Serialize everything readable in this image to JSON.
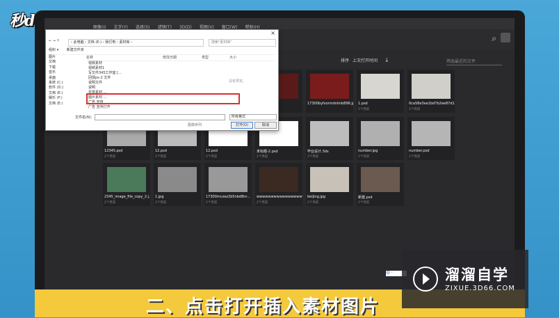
{
  "logo": "秒dong视频",
  "ps": {
    "menu": [
      "图像(I)",
      "文字(Y)",
      "选择(S)",
      "滤镜(T)",
      "3D(D)",
      "视图(V)",
      "窗口(W)",
      "帮助(H)"
    ],
    "sort_label": "排序",
    "sort_value": "上次打开时间",
    "sort_arrow": "↓",
    "filter_placeholder": "筛选最近的文件",
    "search_icon": "search-icon"
  },
  "tiles": [
    {
      "name": "",
      "size": "",
      "thumb": "#222"
    },
    {
      "name": "",
      "size": "",
      "thumb": "#222"
    },
    {
      "name": "",
      "size": "",
      "thumb": "#5a1a1a"
    },
    {
      "name": "17300byfxormdnlmb896.jpg",
      "size": "",
      "thumb": "#7a1c1c"
    },
    {
      "name": "1.psd",
      "size": "2个月前",
      "thumb": "#d8d6d0"
    },
    {
      "name": "0ca58e3ee1bd7b2ee87d1db57...",
      "size": "2个月前",
      "thumb": "#d0cfc9"
    },
    {
      "name": "12345.psd",
      "size": "2个月前",
      "thumb": "#aaaaaa"
    },
    {
      "name": "12.psd",
      "size": "2个月前",
      "thumb": "#bbbbbb"
    },
    {
      "name": "12.psd",
      "size": "2个月前",
      "thumb": "#ffffff"
    },
    {
      "name": "未标题-2.psd",
      "size": "2个月前",
      "thumb": "#ffffff"
    },
    {
      "name": "毕业设计.3ds",
      "size": "2个月前",
      "thumb": "#bdbdbd"
    },
    {
      "name": "number.jpg",
      "size": "2个月前",
      "thumb": "#b0b0b0"
    },
    {
      "name": "number.psd",
      "size": "2个月前",
      "thumb": "#b5b5b5"
    },
    {
      "name": "2345_image_file_copy_2.j...",
      "size": "2个月前",
      "thumb": "#4a7a5a"
    },
    {
      "name": "1.jpg",
      "size": "2个月前",
      "thumb": "#8a8a8a"
    },
    {
      "name": "17300mcxez2b5nbd8nr...",
      "size": "2个月前",
      "thumb": "#999999"
    },
    {
      "name": "wwwwwwwwwwwwwwwwwww...",
      "size": "2个月前",
      "thumb": "#3a2a22"
    },
    {
      "name": "beijing.jpg",
      "size": "2个月前",
      "thumb": "#c7c1b8"
    },
    {
      "name": "新建.psd",
      "size": "2个月前",
      "thumb": "#6a5a50"
    }
  ],
  "dialog": {
    "path": "› 此电脑 › 文档 (E:) › 我们电 › 素材库 ›",
    "search_placeholder": "搜索\"素材库\"",
    "organize": "组织 ▾",
    "new_folder": "新建文件夹",
    "nav": [
      "图片",
      "文档",
      "下载",
      "音乐",
      "桌面",
      "系统 (C:)",
      "软件 (D:)",
      "文档 (E:)",
      "娱乐 (F:)",
      "文档 (E:)"
    ],
    "col_name": "名称",
    "col_date": "修改日期",
    "col_type": "类型",
    "col_size": "大小",
    "no_preview": "没有预览。",
    "rows": [
      "视频素材",
      "视频素材1",
      "写文件345工作室 [...",
      "回馈ps-2 文件",
      "说明文件",
      "说明",
      "花草素材 ...",
      "图片素材 ...",
      "广告 宣传",
      "广告 宣传打开"
    ],
    "filename_label": "文件名(N):",
    "filetype": "所有格式",
    "tool_link": "图像序列",
    "open_btn": "打开(O)",
    "cancel_btn": "取消",
    "close": "×"
  },
  "ime": "中 ·",
  "watermark": {
    "title": "溜溜自学",
    "url": "ZIXUE.3D66.COM"
  },
  "caption": "二、点击打开插入素材图片"
}
